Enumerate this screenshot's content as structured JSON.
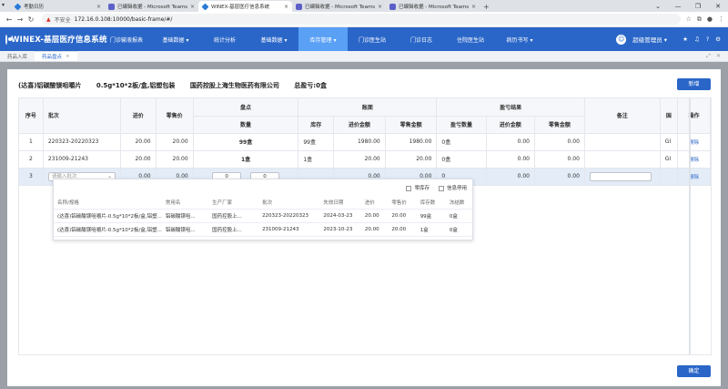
{
  "browser": {
    "tabs": [
      {
        "title": "考勤日历",
        "icon": "app-icon"
      },
      {
        "title": "已编辑收据 - Microsoft Teams",
        "icon": "teams-icon"
      },
      {
        "title": "WINEX-基层医疗信息系统",
        "icon": "app-icon"
      },
      {
        "title": "已编辑收据 - Microsoft Teams",
        "icon": "teams-icon"
      },
      {
        "title": "已编辑收据 - Microsoft Teams",
        "icon": "teams-icon"
      }
    ],
    "insecure_label": "不安全",
    "url": "172.16.0.108:10000/basic-frame/#/"
  },
  "header": {
    "logo_text": "WINEX-基层医疗信息系统",
    "menu": [
      {
        "label": "门诊输液报表",
        "active": false
      },
      {
        "label": "基础数据 ▾",
        "active": false
      },
      {
        "label": "统计分析",
        "active": false
      },
      {
        "label": "基础数据 ▾",
        "active": false
      },
      {
        "label": "库存管理 ▾",
        "active": true
      },
      {
        "label": "门诊医生站",
        "active": false
      },
      {
        "label": "门诊日志",
        "active": false
      },
      {
        "label": "住院医生站",
        "active": false
      },
      {
        "label": "病历书写 ▾",
        "active": false
      }
    ],
    "user": "超级管理员 ▾"
  },
  "page_tabs": [
    {
      "label": "药品入库",
      "active": false
    },
    {
      "label": "药品盘点",
      "active": true
    }
  ],
  "modal": {
    "drug_name": "(达喜)铝碳酸镁咀嚼片",
    "spec": "0.5g*10*2板/盒,铝塑包装",
    "manufacturer": "国药控股上海生物医药有限公司",
    "total_profit": "总盈亏:0盒",
    "add_label": "新增",
    "ok_label": "确定",
    "columns": {
      "seq": "序号",
      "batch": "批次",
      "purchase_price": "进价",
      "retail_price": "零售价",
      "count_group": "盘点",
      "count_qty": "数量",
      "book_group": "账面",
      "stock": "库存",
      "purchase_amount": "进价金额",
      "retail_amount": "零售金额",
      "profit_group": "盈亏结果",
      "profit_qty": "盈亏数量",
      "profit_purchase_amount": "进价金额",
      "profit_retail_amount": "零售金额",
      "note": "备注",
      "country": "国",
      "action": "操作"
    },
    "rows": [
      {
        "seq": "1",
        "batch": "220323-20220323",
        "purchase_price": "20.00",
        "retail_price": "20.00",
        "count_qty": "99盒",
        "stock": "99盒",
        "purchase_amount": "1980.00",
        "retail_amount": "1980.00",
        "profit_qty": "0盒",
        "profit_purchase_amount": "0.00",
        "profit_retail_amount": "0.00",
        "country": "GI",
        "action": "删除"
      },
      {
        "seq": "2",
        "batch": "231009-21243",
        "purchase_price": "20.00",
        "retail_price": "20.00",
        "count_qty": "1盒",
        "stock": "1盒",
        "purchase_amount": "20.00",
        "retail_amount": "20.00",
        "profit_qty": "0盒",
        "profit_purchase_amount": "0.00",
        "profit_retail_amount": "0.00",
        "country": "GI",
        "action": "删除"
      }
    ],
    "edit_row": {
      "seq": "3",
      "batch_placeholder": "请输入批次",
      "purchase_price": "0.00",
      "retail_price": "0.00",
      "qty_box": "0",
      "qty_unit": "0",
      "purchase_amount": "0.00",
      "retail_amount": "0.00",
      "profit_qty": "0",
      "profit_purchase_amount": "0.00",
      "profit_retail_amount": "0.00",
      "action": "删除"
    }
  },
  "dropdown": {
    "opt_zero_stock": "零库存",
    "opt_disabled": "信息停用",
    "columns": [
      "名称/规格",
      "常用名",
      "生产厂家",
      "批次",
      "失效日期",
      "进价",
      "零售价",
      "库存数",
      "冻结数"
    ],
    "rows": [
      [
        "(达喜)铝碳酸镁咀嚼片-0.5g*10*2板/盒,铝塑...",
        "铝碳酸镁咀...",
        "国药控股上...",
        "220323-20220323",
        "2024-03-23",
        "20.00",
        "20.00",
        "99盒",
        "0盒"
      ],
      [
        "(达喜)铝碳酸镁咀嚼片-0.5g*10*2板/盒,铝塑...",
        "铝碳酸镁咀...",
        "国药控股上...",
        "231009-21243",
        "2023-10-23",
        "20.00",
        "20.00",
        "1盒",
        "0盒"
      ]
    ]
  }
}
